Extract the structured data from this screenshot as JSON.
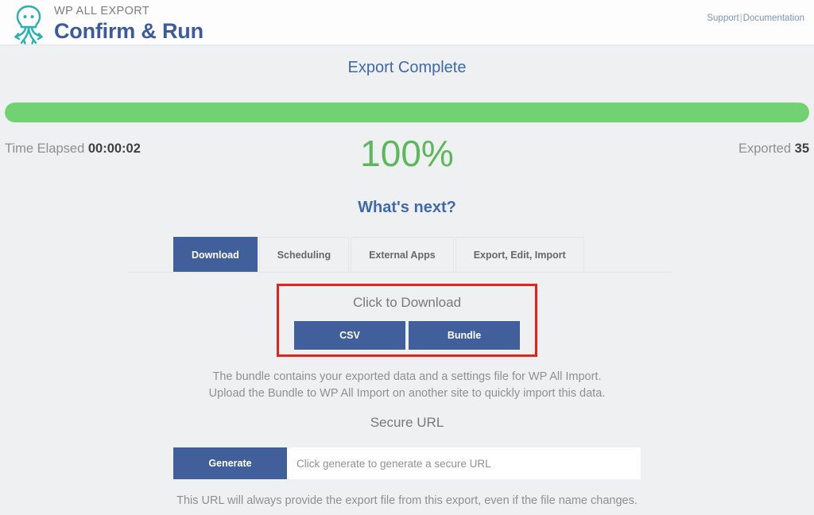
{
  "header": {
    "brand_kicker": "WP ALL EXPORT",
    "brand_title": "Confirm & Run",
    "logo_icon": "octopus-logo-icon",
    "links": {
      "support": "Support",
      "separator": "|",
      "documentation": "Documentation"
    }
  },
  "status": {
    "heading": "Export Complete",
    "progress_percent": 100,
    "progress_label": "100%",
    "time_elapsed_label": "Time Elapsed",
    "time_elapsed_value": "00:00:02",
    "exported_label": "Exported",
    "exported_value": "35"
  },
  "whats_next": {
    "heading": "What's next?",
    "tabs": [
      {
        "label": "Download",
        "active": true
      },
      {
        "label": "Scheduling",
        "active": false
      },
      {
        "label": "External Apps",
        "active": false
      },
      {
        "label": "Export, Edit, Import",
        "active": false
      }
    ]
  },
  "download": {
    "title": "Click to Download",
    "csv_label": "CSV",
    "bundle_label": "Bundle",
    "note_line1": "The bundle contains your exported data and a settings file for WP All Import.",
    "note_line2": "Upload the Bundle to WP All Import on another site to quickly import this data."
  },
  "secure_url": {
    "title": "Secure URL",
    "generate_label": "Generate",
    "input_value": "",
    "input_placeholder": "Click generate to generate a secure URL",
    "note": "This URL will always provide the export file from this export, even if the file name changes."
  },
  "colors": {
    "accent_blue": "#41609b",
    "heading_blue": "#3f69ad",
    "progress_green": "#72d173",
    "percent_green": "#5cb85c",
    "highlight_red": "#e8211a",
    "page_background": "#eff0f1",
    "logo_teal": "#26b2b5"
  }
}
